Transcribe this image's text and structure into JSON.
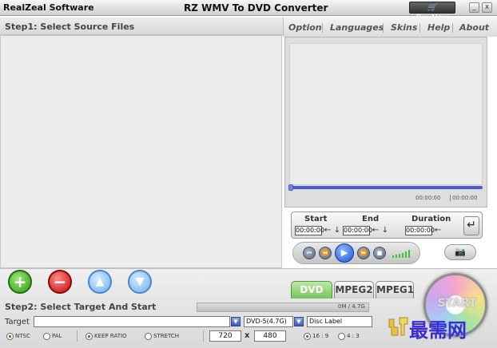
{
  "titlebar": {
    "brand": "RealZeal Software",
    "title": "RZ WMV To DVD Converter",
    "buy_now": "BuyNow",
    "minimize": "_",
    "close": "x"
  },
  "step1": {
    "label": "Step1: Select Source Files"
  },
  "menu": {
    "items": [
      "Option",
      "Languages",
      "Skins",
      "Help",
      "About"
    ]
  },
  "preview": {
    "time_current": "00:00:00",
    "time_total": "00:00:00"
  },
  "trim": {
    "start_label": "Start",
    "end_label": "End",
    "duration_label": "Duration",
    "start": "00:00:00",
    "end": "00:00:00",
    "duration": "00:00:00"
  },
  "toolbar": {
    "add": "+",
    "remove": "−",
    "up": "▲",
    "down": "▼"
  },
  "format_tabs": [
    "DVD",
    "MPEG2",
    "MPEG1"
  ],
  "step2": {
    "label": "Step2: Select Target And Start",
    "size_display": "0M / 4.7G"
  },
  "target": {
    "label": "Target",
    "value": "",
    "disc_type": "DVD-5(4.7G)",
    "disc_label": "Disc Label"
  },
  "options": {
    "ntsc": "NTSC",
    "pal": "PAL",
    "keep_ratio": "KEEP RATIO",
    "stretch": "STRETCH",
    "width": "720",
    "x": "x",
    "height": "480",
    "ratio_169": "16 : 9",
    "ratio_43": "4 : 3"
  },
  "start": {
    "label": "START"
  },
  "watermark": {
    "text": "最需网"
  },
  "colors": {
    "accent_green": "#76c45a",
    "progress_blue": "#4b5bd6",
    "watermark": "#3a2ad8"
  }
}
